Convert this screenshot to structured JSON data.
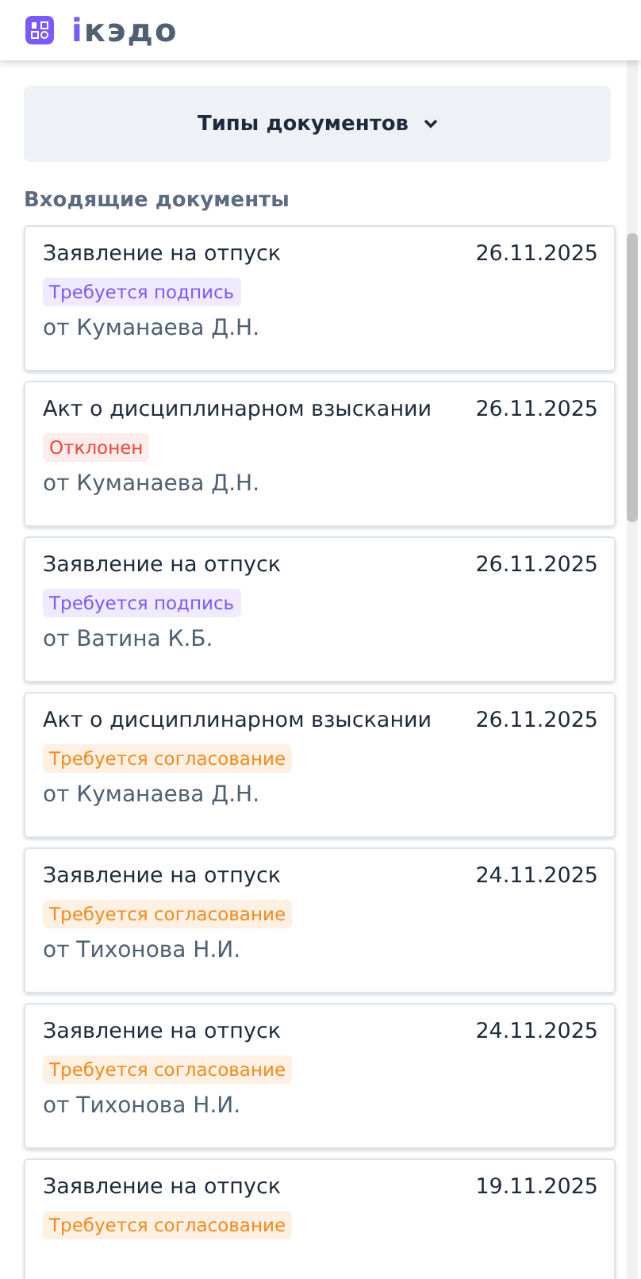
{
  "header": {
    "logo_text": "ікэдо"
  },
  "filter_button": {
    "label": "Типы документов"
  },
  "section_title": "Входящие документы",
  "documents": [
    {
      "title": "Заявление на отпуск",
      "date": "26.11.2025",
      "status": {
        "label": "Требуется подпись",
        "kind": "signature"
      },
      "from": "от Куманаева Д.Н."
    },
    {
      "title": "Акт о дисциплинарном взыскании",
      "date": "26.11.2025",
      "status": {
        "label": "Отклонен",
        "kind": "rejected"
      },
      "from": "от Куманаева Д.Н."
    },
    {
      "title": "Заявление на отпуск",
      "date": "26.11.2025",
      "status": {
        "label": "Требуется подпись",
        "kind": "signature"
      },
      "from": "от Ватина К.Б."
    },
    {
      "title": "Акт о дисциплинарном взыскании",
      "date": "26.11.2025",
      "status": {
        "label": "Требуется согласование",
        "kind": "approval"
      },
      "from": "от Куманаева Д.Н."
    },
    {
      "title": "Заявление на отпуск",
      "date": "24.11.2025",
      "status": {
        "label": "Требуется согласование",
        "kind": "approval"
      },
      "from": "от Тихонова Н.И."
    },
    {
      "title": "Заявление на отпуск",
      "date": "24.11.2025",
      "status": {
        "label": "Требуется согласование",
        "kind": "approval"
      },
      "from": "от Тихонова Н.И."
    },
    {
      "title": "Заявление на отпуск",
      "date": "19.11.2025",
      "status": {
        "label": "Требуется согласование",
        "kind": "approval"
      }
    }
  ]
}
